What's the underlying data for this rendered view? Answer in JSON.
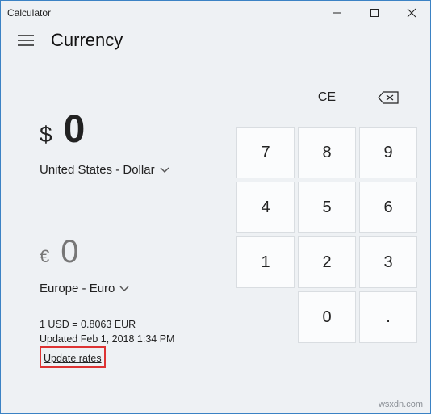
{
  "window": {
    "title": "Calculator"
  },
  "header": {
    "title": "Currency"
  },
  "from": {
    "symbol": "$",
    "value": "0",
    "picker_label": "United States - Dollar"
  },
  "to": {
    "symbol": "€",
    "value": "0",
    "picker_label": "Europe - Euro"
  },
  "rate": {
    "line": "1 USD = 0.8063 EUR",
    "updated": "Updated Feb 1, 2018 1:34 PM",
    "update_link": "Update rates"
  },
  "keypad": {
    "ce": "CE",
    "backspace_icon": "backspace-icon",
    "keys": [
      "7",
      "8",
      "9",
      "4",
      "5",
      "6",
      "1",
      "2",
      "3",
      "",
      "0",
      "."
    ]
  },
  "watermark": "wsxdn.com"
}
